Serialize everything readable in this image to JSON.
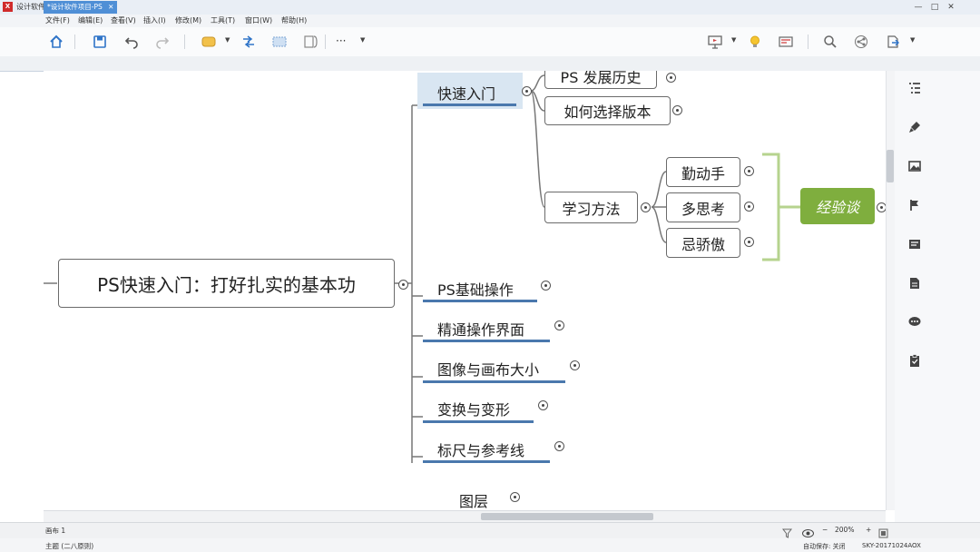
{
  "window": {
    "title": "设计软件项目-PS.xmind",
    "app_badge": "X",
    "controls": [
      "—",
      "□",
      "✕"
    ]
  },
  "menu": [
    "文件(F)",
    "编辑(E)",
    "查看(V)",
    "插入(I)",
    "修改(M)",
    "工具(T)",
    "窗口(W)",
    "帮助(H)"
  ],
  "toolbar": {
    "icons": [
      "home-icon",
      "save-icon",
      "undo-icon",
      "redo-icon",
      "topic-style-icon",
      "relationship-icon",
      "boundary-icon",
      "summary-icon",
      "more-icon",
      "presentation-icon",
      "idea-icon",
      "layout-icon",
      "zoom-search-icon",
      "share-icon",
      "export-icon"
    ],
    "more_label": "···"
  },
  "tab": {
    "label": "*设计软件项目-PS",
    "close": "✕"
  },
  "mindmap": {
    "central": "PS快速入门：打好扎实的基本功",
    "branch_quickstart": "快速入门",
    "sub_history": "PS 发展历史",
    "sub_version": "如何选择版本",
    "sub_method": "学习方法",
    "method_children": [
      "勤动手",
      "多思考",
      "忌骄傲"
    ],
    "summary": "经验谈",
    "branches": [
      "PS基础操作",
      "精通操作界面",
      "图像与画布大小",
      "变换与变形",
      "标尺与参考线",
      "图层"
    ]
  },
  "statusbar": {
    "sheet": "画布 1",
    "zoom": "200%",
    "zoom_minus": "−",
    "zoom_plus": "+"
  },
  "bottombar": {
    "left": "主题 (二八原则)",
    "autosave": "自动保存: 关闭",
    "user": "SKY-20171024AOX"
  },
  "colors": {
    "accent": "#4f8fd6",
    "underline": "#4a78ad",
    "summary_bg": "#7fae3e",
    "bracket": "#b6d38e"
  }
}
